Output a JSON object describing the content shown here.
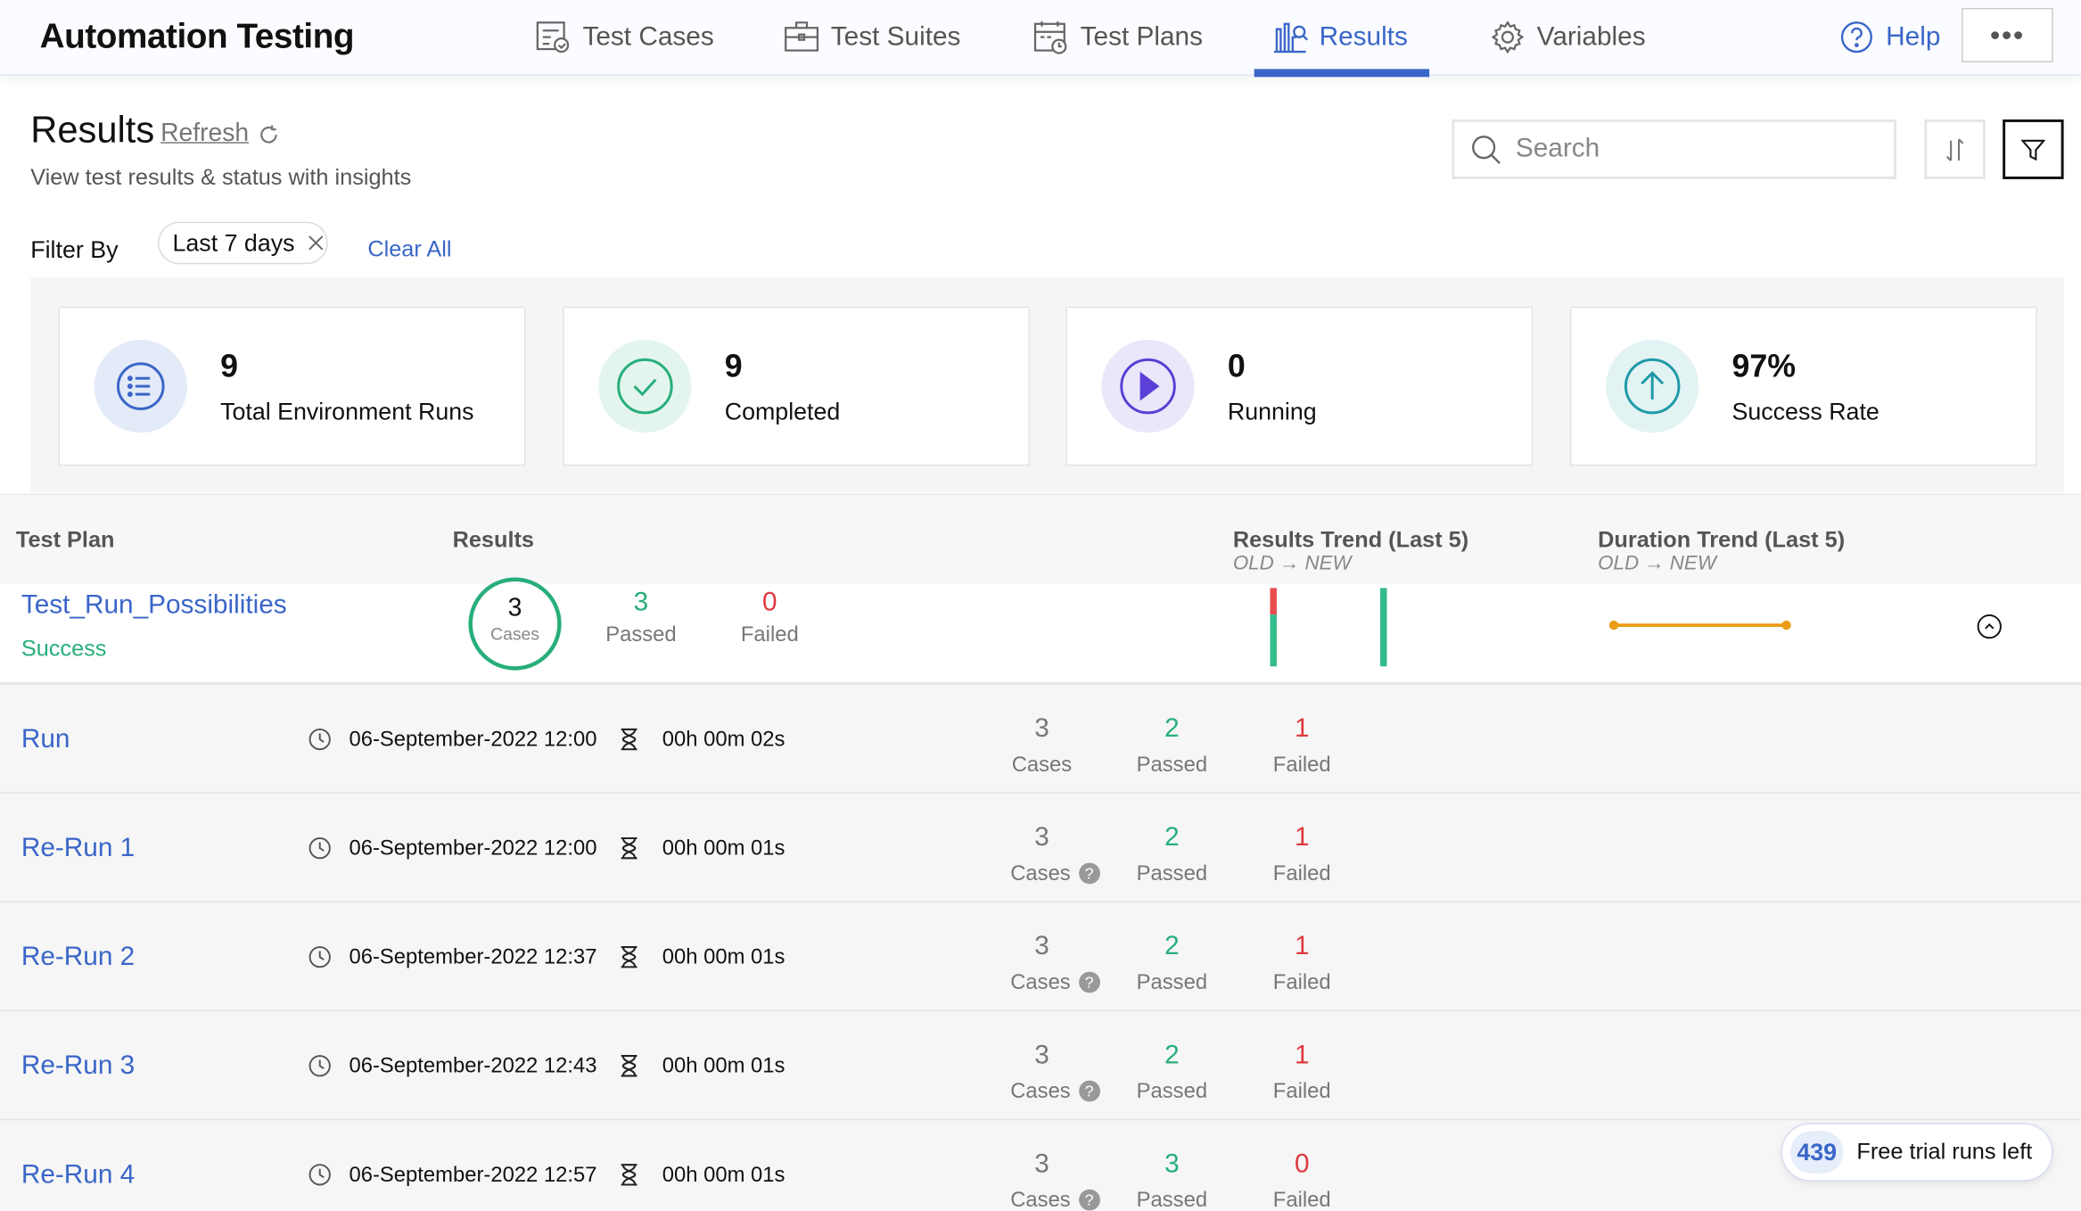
{
  "header": {
    "title": "Automation Testing",
    "nav": [
      {
        "label": "Test Cases",
        "icon": "test-cases-icon"
      },
      {
        "label": "Test Suites",
        "icon": "briefcase-icon"
      },
      {
        "label": "Test Plans",
        "icon": "calendar-icon"
      },
      {
        "label": "Results",
        "icon": "chart-icon",
        "active": true
      },
      {
        "label": "Variables",
        "icon": "gear-icon"
      }
    ],
    "help": "Help",
    "more": "•••"
  },
  "page": {
    "title": "Results",
    "refresh": "Refresh",
    "subtitle": "View test results & status with insights",
    "search_placeholder": "Search"
  },
  "filter": {
    "label": "Filter By",
    "chip": "Last 7 days",
    "clear": "Clear All"
  },
  "stats": [
    {
      "value": "9",
      "label": "Total Environment Runs",
      "color": "#3a66c8"
    },
    {
      "value": "9",
      "label": "Completed",
      "color": "#27ae7a"
    },
    {
      "value": "0",
      "label": "Running",
      "color": "#5b3fd6"
    },
    {
      "value": "97%",
      "label": "Success Rate",
      "color": "#1f9aa8"
    }
  ],
  "table": {
    "headers": {
      "plan": "Test Plan",
      "results": "Results",
      "results_trend": "Results Trend (Last 5)",
      "duration_trend": "Duration Trend (Last 5)",
      "old": "OLD",
      "new": "NEW"
    }
  },
  "plan": {
    "name": "Test_Run_Possibilities",
    "status": "Success",
    "cases": "3",
    "cases_label": "Cases",
    "passed": "3",
    "passed_label": "Passed",
    "failed": "0",
    "failed_label": "Failed"
  },
  "runs": [
    {
      "name": "Run",
      "date": "06-September-2022 12:00",
      "duration": "00h 00m 02s",
      "cases": "3",
      "passed": "2",
      "failed": "1",
      "help": false
    },
    {
      "name": "Re-Run 1",
      "date": "06-September-2022 12:00",
      "duration": "00h 00m 01s",
      "cases": "3",
      "passed": "2",
      "failed": "1",
      "help": true
    },
    {
      "name": "Re-Run 2",
      "date": "06-September-2022 12:37",
      "duration": "00h 00m 01s",
      "cases": "3",
      "passed": "2",
      "failed": "1",
      "help": true
    },
    {
      "name": "Re-Run 3",
      "date": "06-September-2022 12:43",
      "duration": "00h 00m 01s",
      "cases": "3",
      "passed": "2",
      "failed": "1",
      "help": true
    },
    {
      "name": "Re-Run 4",
      "date": "06-September-2022 12:57",
      "duration": "00h 00m 01s",
      "cases": "3",
      "passed": "3",
      "failed": "0",
      "help": true
    }
  ],
  "labels": {
    "cases": "Cases",
    "passed": "Passed",
    "failed": "Failed",
    "help": "?"
  },
  "trial": {
    "count": "439",
    "text": "Free trial runs left"
  }
}
